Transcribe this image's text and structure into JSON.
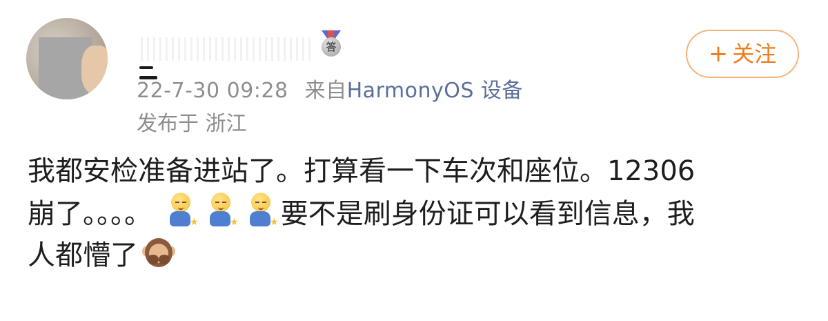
{
  "post": {
    "username_masked": "",
    "badge_icon": "medal-icon",
    "badge_text": "答",
    "meta": {
      "date": "22-7-30 09:28",
      "source_prefix": "来自",
      "source": "HarmonyOS 设备"
    },
    "location": "发布于 浙江",
    "follow_button": {
      "plus": "+",
      "label": "关注"
    },
    "text": {
      "line1": "我都安检准备进站了。打算看一下车次和座位。12306",
      "line2_a": "崩了。。。。",
      "line2_b": "要不是刷身份证可以看到信息，我",
      "line3": "人都懵了"
    },
    "emojis": [
      "person-meditating-icon",
      "person-meditating-icon",
      "person-meditating-icon",
      "see-no-evil-monkey-icon"
    ],
    "colors": {
      "follow_accent": "#f07b1d",
      "source_link": "#5c6f9c",
      "meta_gray": "#8e8e8e"
    }
  }
}
